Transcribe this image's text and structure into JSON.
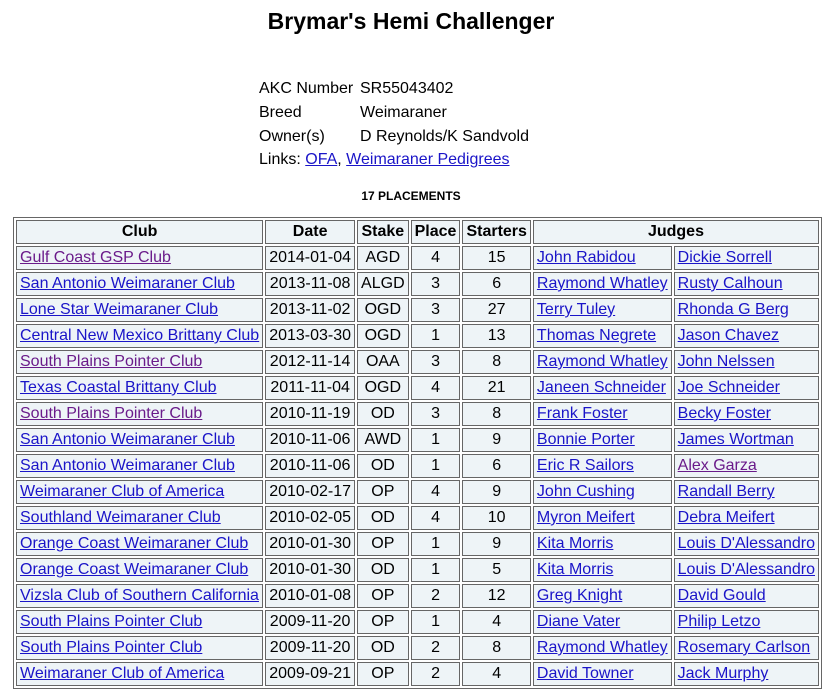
{
  "title": "Brymar's Hemi Challenger",
  "info": [
    {
      "label": "AKC Number",
      "value": "SR55043402"
    },
    {
      "label": "Breed",
      "value": "Weimaraner"
    },
    {
      "label": "Owner(s)",
      "value": "D Reynolds/K Sandvold"
    }
  ],
  "links": {
    "label": "Links:",
    "ofa": "OFA",
    "sep": ",",
    "pedigrees": "Weimaraner Pedigrees"
  },
  "placements_heading": "17 PLACEMENTS",
  "table": {
    "headers": {
      "club": "Club",
      "date": "Date",
      "stake": "Stake",
      "place": "Place",
      "starters": "Starters",
      "judges": "Judges"
    },
    "rows": [
      {
        "club": "Gulf Coast GSP Club",
        "visited": true,
        "date": "2014-01-04",
        "stake": "AGD",
        "place": "4",
        "starters": "15",
        "judge1": "John Rabidou",
        "judge2": "Dickie Sorrell"
      },
      {
        "club": "San Antonio Weimaraner Club",
        "date": "2013-11-08",
        "stake": "ALGD",
        "place": "3",
        "starters": "6",
        "judge1": "Raymond Whatley",
        "judge2": "Rusty Calhoun"
      },
      {
        "club": "Lone Star Weimaraner Club",
        "date": "2013-11-02",
        "stake": "OGD",
        "place": "3",
        "starters": "27",
        "judge1": "Terry Tuley",
        "judge2": "Rhonda G Berg"
      },
      {
        "club": "Central New Mexico Brittany Club",
        "date": "2013-03-30",
        "stake": "OGD",
        "place": "1",
        "starters": "13",
        "judge1": "Thomas Negrete",
        "judge2": "Jason Chavez"
      },
      {
        "club": "South Plains Pointer Club",
        "visited": true,
        "date": "2012-11-14",
        "stake": "OAA",
        "place": "3",
        "starters": "8",
        "judge1": "Raymond Whatley",
        "judge2": "John Nelssen"
      },
      {
        "club": "Texas Coastal Brittany Club",
        "date": "2011-11-04",
        "stake": "OGD",
        "place": "4",
        "starters": "21",
        "judge1": "Janeen Schneider",
        "judge2": "Joe Schneider"
      },
      {
        "club": "South Plains Pointer Club",
        "visited": true,
        "date": "2010-11-19",
        "stake": "OD",
        "place": "3",
        "starters": "8",
        "judge1": "Frank Foster",
        "judge2": "Becky Foster"
      },
      {
        "club": "San Antonio Weimaraner Club",
        "date": "2010-11-06",
        "stake": "AWD",
        "place": "1",
        "starters": "9",
        "judge1": "Bonnie Porter",
        "judge2": "James Wortman"
      },
      {
        "club": "San Antonio Weimaraner Club",
        "date": "2010-11-06",
        "stake": "OD",
        "place": "1",
        "starters": "6",
        "judge1": "Eric R Sailors",
        "judge2": "Alex Garza",
        "judge2_visited": true
      },
      {
        "club": "Weimaraner Club of America",
        "date": "2010-02-17",
        "stake": "OP",
        "place": "4",
        "starters": "9",
        "judge1": "John Cushing",
        "judge2": "Randall Berry"
      },
      {
        "club": "Southland Weimaraner Club",
        "date": "2010-02-05",
        "stake": "OD",
        "place": "4",
        "starters": "10",
        "judge1": "Myron Meifert",
        "judge2": "Debra Meifert"
      },
      {
        "club": "Orange Coast Weimaraner Club",
        "date": "2010-01-30",
        "stake": "OP",
        "place": "1",
        "starters": "9",
        "judge1": "Kita Morris",
        "judge2": "Louis D'Alessandro"
      },
      {
        "club": "Orange Coast Weimaraner Club",
        "date": "2010-01-30",
        "stake": "OD",
        "place": "1",
        "starters": "5",
        "judge1": "Kita Morris",
        "judge2": "Louis D'Alessandro"
      },
      {
        "club": "Vizsla Club of Southern California",
        "date": "2010-01-08",
        "stake": "OP",
        "place": "2",
        "starters": "12",
        "judge1": "Greg Knight",
        "judge2": "David Gould"
      },
      {
        "club": "South Plains Pointer Club",
        "date": "2009-11-20",
        "stake": "OP",
        "place": "1",
        "starters": "4",
        "judge1": "Diane Vater",
        "judge2": "Philip Letzo"
      },
      {
        "club": "South Plains Pointer Club",
        "date": "2009-11-20",
        "stake": "OD",
        "place": "2",
        "starters": "8",
        "judge1": "Raymond Whatley",
        "judge2": "Rosemary Carlson"
      },
      {
        "club": "Weimaraner Club of America",
        "date": "2009-09-21",
        "stake": "OP",
        "place": "2",
        "starters": "4",
        "judge1": "David Towner",
        "judge2": "Jack Murphy"
      }
    ]
  },
  "colors": {
    "link": "#1a14c8",
    "visited_link": "#6a1b8a",
    "cell_bg": "#eef4f7"
  }
}
